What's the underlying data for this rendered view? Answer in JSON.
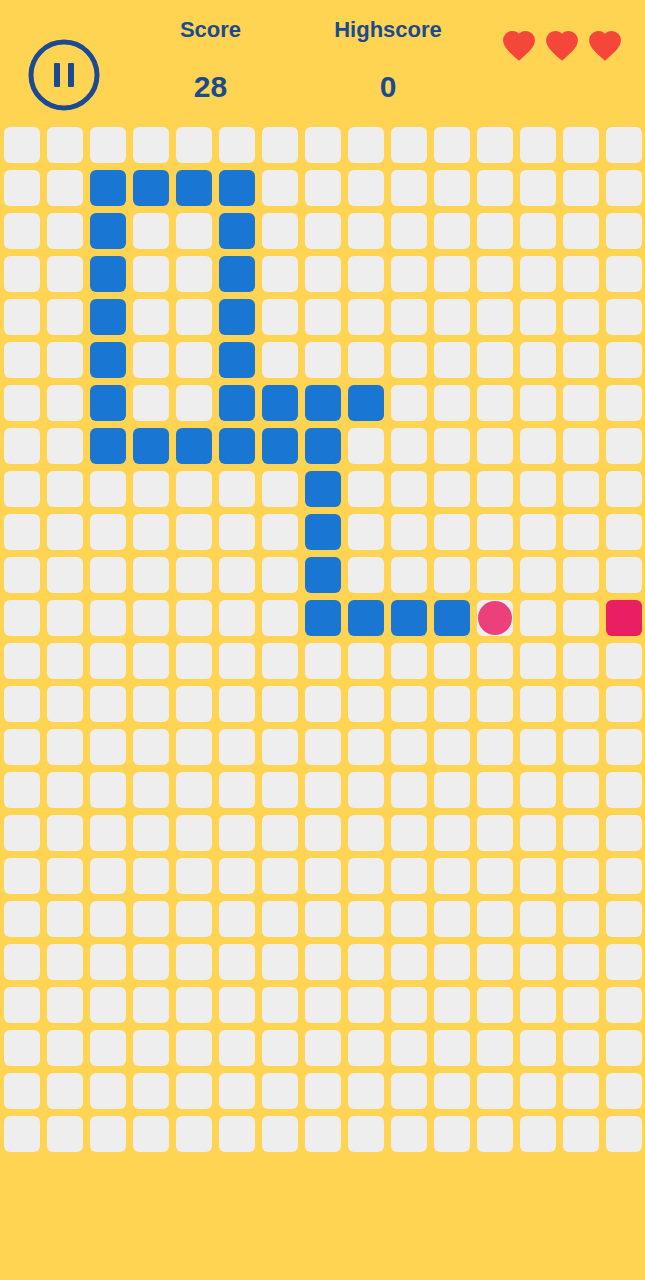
{
  "header": {
    "pause_button": {
      "paused": false
    },
    "score": {
      "label": "Score",
      "value": "28"
    },
    "highscore": {
      "label": "Highscore",
      "value": "0"
    },
    "lives": [
      {
        "filled": true
      },
      {
        "filled": true
      },
      {
        "filled": true
      }
    ]
  },
  "board": {
    "columns": 15,
    "rows": 24,
    "snake_color": "#1976d2",
    "snake": [
      [
        2,
        1
      ],
      [
        3,
        1
      ],
      [
        4,
        1
      ],
      [
        5,
        1
      ],
      [
        2,
        2
      ],
      [
        5,
        2
      ],
      [
        2,
        3
      ],
      [
        5,
        3
      ],
      [
        2,
        4
      ],
      [
        5,
        4
      ],
      [
        2,
        5
      ],
      [
        5,
        5
      ],
      [
        2,
        6
      ],
      [
        5,
        6
      ],
      [
        6,
        6
      ],
      [
        7,
        6
      ],
      [
        8,
        6
      ],
      [
        2,
        7
      ],
      [
        3,
        7
      ],
      [
        4,
        7
      ],
      [
        5,
        7
      ],
      [
        6,
        7
      ],
      [
        7,
        7
      ],
      [
        7,
        8
      ],
      [
        7,
        9
      ],
      [
        7,
        10
      ],
      [
        7,
        11
      ],
      [
        8,
        11
      ],
      [
        9,
        11
      ],
      [
        10,
        11
      ]
    ],
    "items": [
      {
        "kind": "circle",
        "col": 11,
        "row": 11,
        "color": "#ec407a"
      },
      {
        "kind": "square",
        "col": 14,
        "row": 11,
        "color": "#e91e63"
      }
    ]
  }
}
